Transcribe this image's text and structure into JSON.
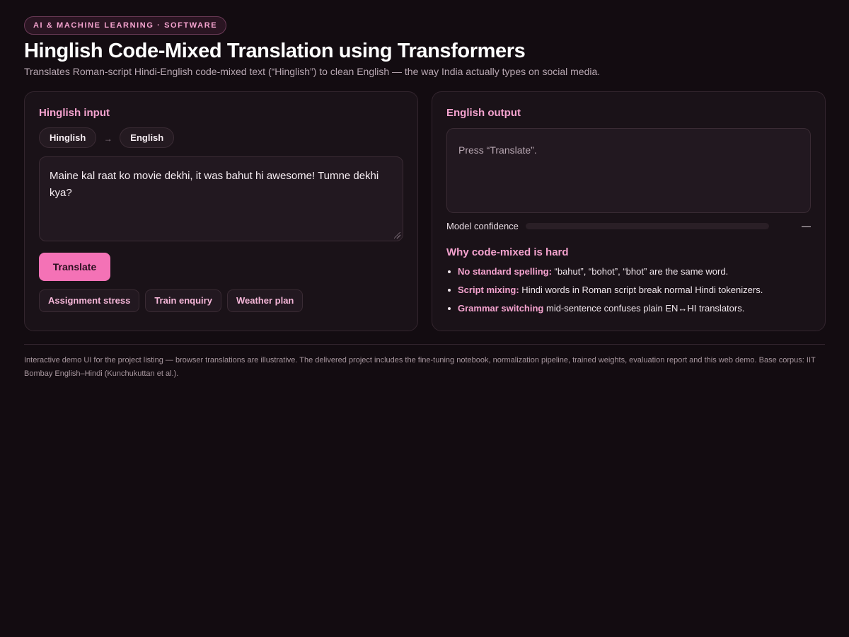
{
  "header": {
    "badge": "AI & MACHINE LEARNING · SOFTWARE",
    "title": "Hinglish Code-Mixed Translation using Transformers",
    "subtitle": "Translates Roman-script Hindi-English code-mixed text (“Hinglish”) to clean English — the way India actually types on social media."
  },
  "input_card": {
    "title": "Hinglish input",
    "source_lang": "Hinglish",
    "arrow": "→",
    "target_lang": "English",
    "text": "Maine kal raat ko movie dekhi, it was bahut hi awesome! Tumne dekhi kya?",
    "translate_label": "Translate",
    "samples": [
      "Assignment stress",
      "Train enquiry",
      "Weather plan"
    ]
  },
  "output_card": {
    "title": "English output",
    "placeholder": "Press “Translate”.",
    "confidence_label": "Model confidence",
    "confidence_value": "—",
    "confidence_fraction": 0,
    "why_title": "Why code-mixed is hard",
    "why_items": [
      {
        "bold": "No standard spelling:",
        "text": " “bahut”, “bohot”, “bhot” are the same word."
      },
      {
        "bold": "Script mixing:",
        "text": " Hindi words in Roman script break normal Hindi tokenizers."
      },
      {
        "bold": "Grammar switching",
        "text": " mid-sentence confuses plain EN↔HI translators."
      }
    ]
  },
  "footer": "Interactive demo UI for the project listing — browser translations are illustrative. The delivered project includes the fine-tuning notebook, normalization pipeline, trained weights, evaluation report and this web demo. Base corpus: IIT Bombay English–Hindi (Kunchukuttan et al.).",
  "colors": {
    "accent": "#f472b6",
    "background": "#130c11",
    "card": "#1a1218"
  }
}
